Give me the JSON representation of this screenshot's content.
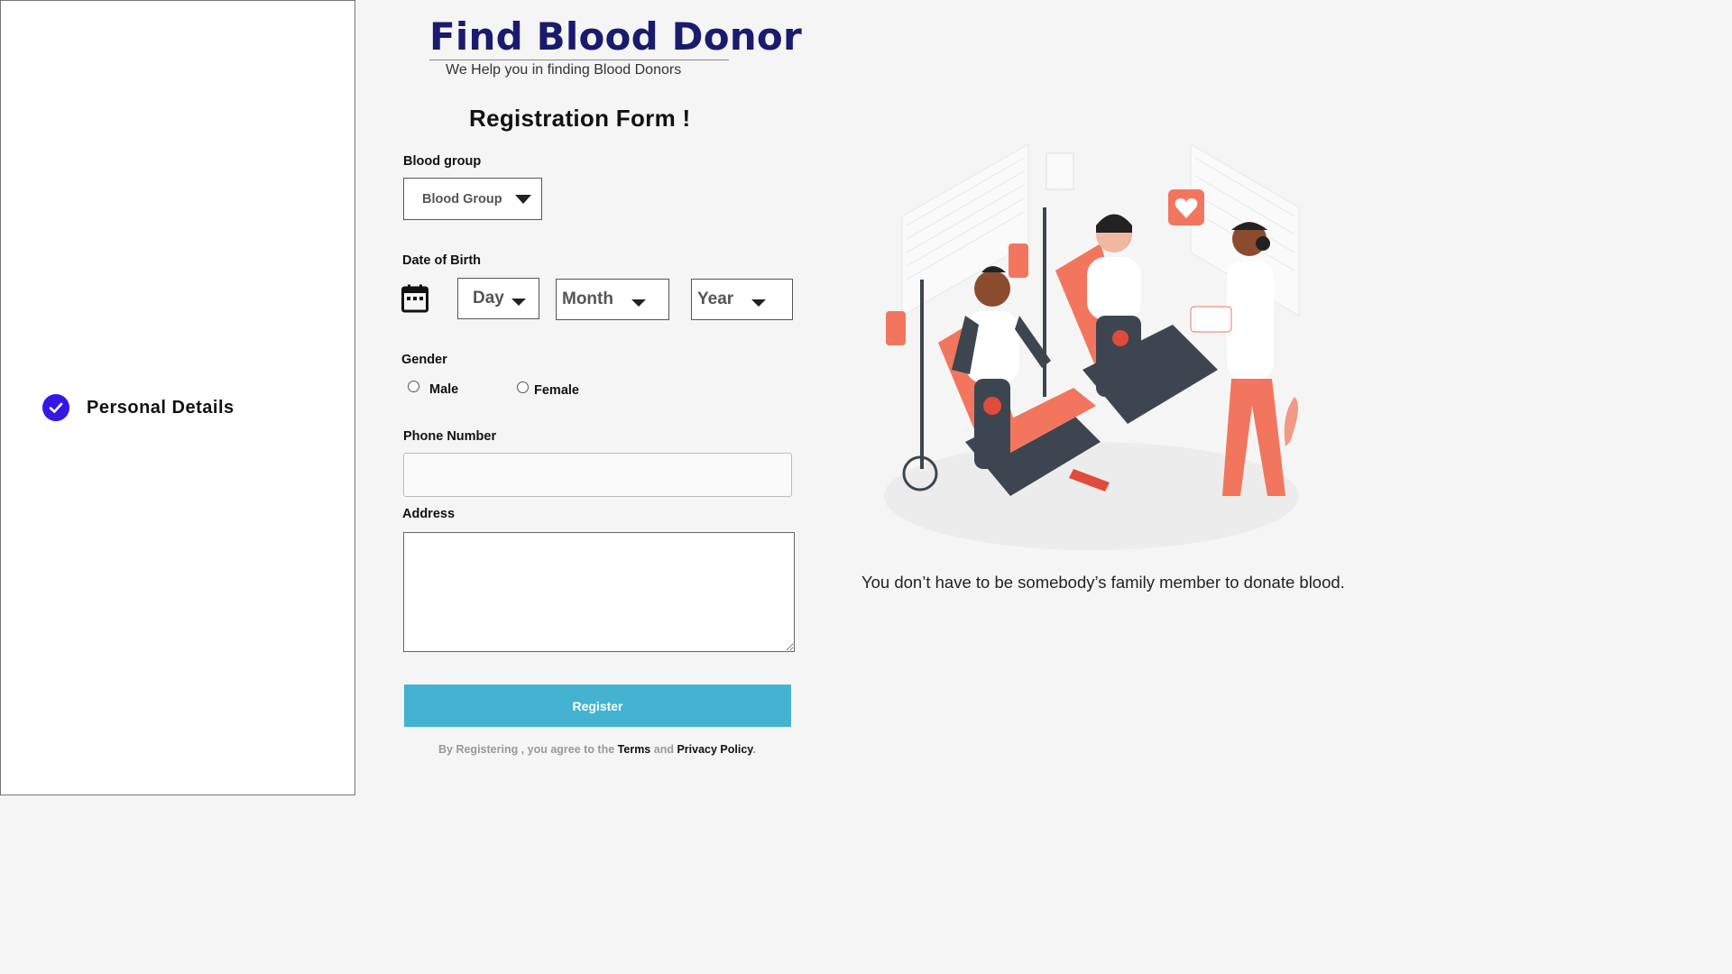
{
  "sidebar": {
    "steps": [
      {
        "label": "Personal Details",
        "status": "completed"
      }
    ]
  },
  "header": {
    "title": "Find Blood Donor",
    "subtitle": "We Help you in finding Blood Donors"
  },
  "form": {
    "title": "Registration Form !",
    "blood_group": {
      "label": "Blood group",
      "placeholder": "Blood Group"
    },
    "dob": {
      "label": "Date of Birth",
      "day": "Day",
      "month": "Month",
      "year": "Year"
    },
    "gender": {
      "label": "Gender",
      "options": [
        "Male",
        "Female"
      ]
    },
    "phone": {
      "label": "Phone Number",
      "value": ""
    },
    "address": {
      "label": "Address",
      "value": ""
    },
    "register_label": "Register",
    "terms": {
      "prefix": "By Registering , you agree to the",
      "terms_link": "Terms",
      "and": "and",
      "privacy_link": "Privacy Policy",
      "suffix": "."
    }
  },
  "illustration": {
    "caption": "You don’t have to be somebody’s family member to donate blood."
  },
  "colors": {
    "accent": "#43b3d1",
    "step_check": "#3318e6",
    "brand": "#1a1a6e",
    "illustration_primary": "#f2765e"
  },
  "icons": [
    "check-icon",
    "calendar-icon",
    "caret-down-icon"
  ]
}
